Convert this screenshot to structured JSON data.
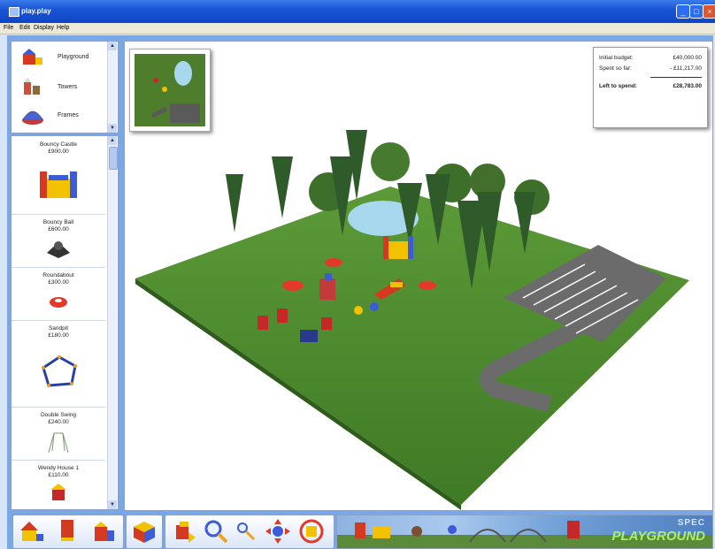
{
  "window": {
    "title": "play.play"
  },
  "menu": [
    "File",
    "Edit",
    "Display",
    "Help"
  ],
  "tools": [
    {
      "label": "Playground",
      "icon": "playground-icon"
    },
    {
      "label": "Towers",
      "icon": "towers-icon"
    },
    {
      "label": "Frames",
      "icon": "frames-icon"
    }
  ],
  "catalog": [
    {
      "name": "Bouncy Castle",
      "price": "£900.00",
      "icon": "bouncy-castle-icon"
    },
    {
      "name": "Bouncy Ball",
      "price": "£600.00",
      "icon": "bouncy-ball-icon"
    },
    {
      "name": "Roundabout",
      "price": "£300.00",
      "icon": "roundabout-icon"
    },
    {
      "name": "Sandpit",
      "price": "£180.00",
      "icon": "sandpit-icon"
    },
    {
      "name": "Double Swing",
      "price": "£240.00",
      "icon": "double-swing-icon"
    },
    {
      "name": "Wendy House 1",
      "price": "£110.00",
      "icon": "wendy-house-icon"
    }
  ],
  "budget": {
    "initial_label": "Initial budget:",
    "initial_value": "£40,000.00",
    "spent_label": "Spent so far:",
    "spent_value": "- £11,217.00",
    "left_label": "Left to spend:",
    "left_value": "£28,783.00"
  },
  "toolbar": [
    "build-house-icon",
    "build-tower-icon",
    "build-slide-icon",
    "rotate-cube-icon",
    "move-object-icon",
    "zoom-in-icon",
    "zoom-out-icon",
    "pan-icon",
    "rotate-view-icon"
  ],
  "brand": {
    "line1": "SPEC",
    "line2": "PLAYGROUND"
  },
  "colors": {
    "title_bar": "#1a55d6",
    "frame": "#7aa7e6",
    "grass": "#4e8a2e",
    "pond": "#a8d8ee",
    "tarmac": "#6b6b6b",
    "brand_green": "#aaf06a"
  }
}
